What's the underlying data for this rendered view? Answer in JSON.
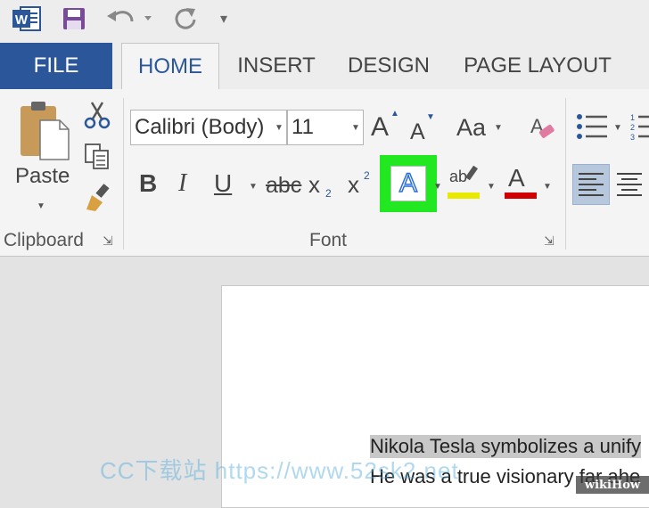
{
  "quick_access": {
    "app_icon_letter": "W",
    "customize_label": "▾"
  },
  "tabs": [
    {
      "label": "FILE"
    },
    {
      "label": "HOME"
    },
    {
      "label": "INSERT"
    },
    {
      "label": "DESIGN"
    },
    {
      "label": "PAGE LAYOUT"
    }
  ],
  "clipboard": {
    "paste_label": "Paste",
    "group_label": "Clipboard"
  },
  "font": {
    "font_name": "Calibri (Body)",
    "font_size": "11",
    "grow_label": "A",
    "shrink_label": "A",
    "change_case_label": "Aa",
    "bold_label": "B",
    "italic_label": "I",
    "underline_label": "U",
    "strike_label": "abc",
    "subscript_label": "x",
    "subscript_mark": "2",
    "superscript_label": "x",
    "superscript_mark": "2",
    "text_effects_label": "A",
    "highlight_label": "ab",
    "font_color_label": "A",
    "group_label": "Font"
  },
  "colors": {
    "accent": "#2b579a",
    "text_effects_highlight": "#22e822",
    "highlight_bar": "#e8e800",
    "font_color_bar": "#d00000",
    "align_selected": "#b8c8dc"
  },
  "document": {
    "line1": "Nikola Tesla symbolizes a unify",
    "line2": "He was a true visionary far ahe"
  },
  "overlay": {
    "watermark": "CC下载站 https://www.52sk2.net",
    "badge": "wikiHow"
  }
}
